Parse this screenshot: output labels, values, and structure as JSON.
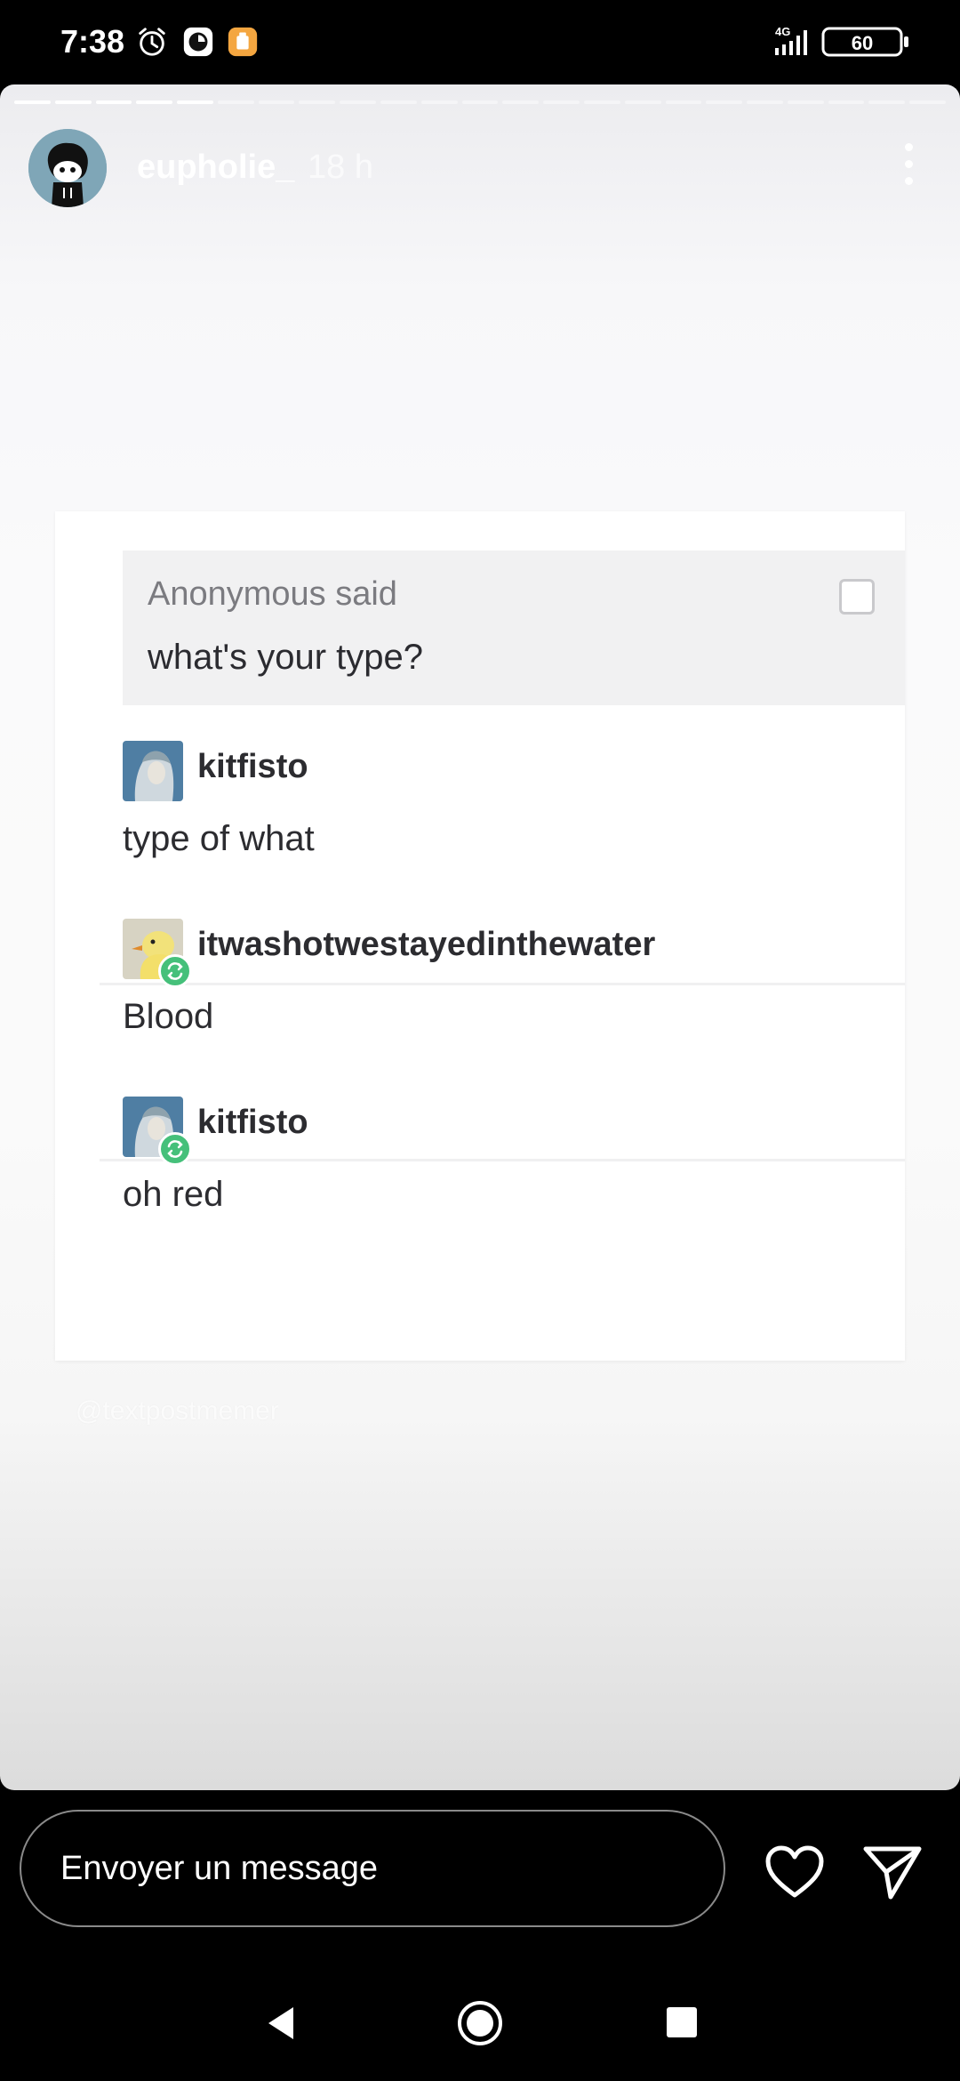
{
  "status_bar": {
    "time": "7:38",
    "network": "4G",
    "battery": "60",
    "icons": [
      "alarm-icon",
      "notification-circle-icon",
      "app-notification-icon",
      "signal-icon",
      "battery-icon"
    ]
  },
  "story": {
    "username": "eupholie_",
    "time_ago": "18 h",
    "progress": {
      "segments_total": 23,
      "segments_viewed": 5
    },
    "post": {
      "ask": {
        "from": "Anonymous said",
        "question": "what's your type?"
      },
      "replies": [
        {
          "username": "kitfisto",
          "text": "type of what",
          "reblog": false
        },
        {
          "username": "itwashotwestayedinthewater",
          "text": "Blood",
          "reblog": true
        },
        {
          "username": "kitfisto",
          "text": "oh red",
          "reblog": true
        }
      ]
    },
    "watermark": "@textpostmemer"
  },
  "reply_bar": {
    "placeholder": "Envoyer un message"
  },
  "colors": {
    "background": "#000000",
    "reblog_green": "#45c07a",
    "ask_background": "#f1f1f2"
  }
}
